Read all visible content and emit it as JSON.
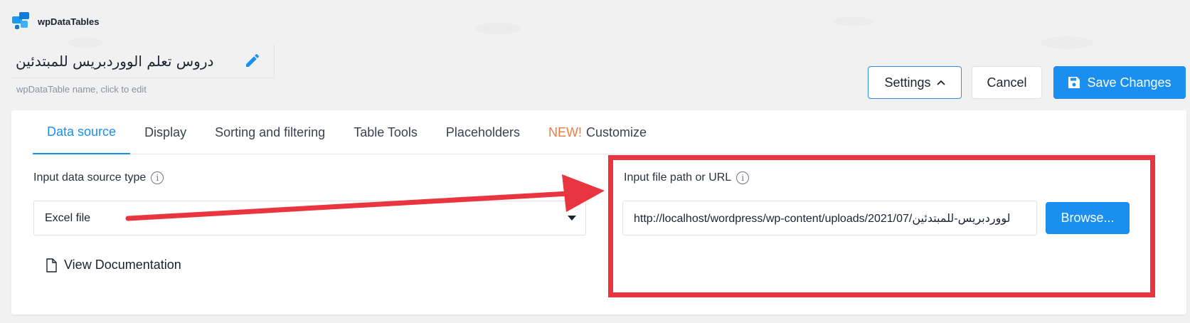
{
  "app": {
    "logo_text": "wpDataTables"
  },
  "table_name": {
    "value": "دروس تعلم الووردبريس للمبتدئين",
    "hint": "wpDataTable name, click to edit"
  },
  "toolbar": {
    "settings_label": "Settings",
    "cancel_label": "Cancel",
    "save_label": "Save Changes"
  },
  "tabs": [
    {
      "label": "Data source",
      "active": true
    },
    {
      "label": "Display"
    },
    {
      "label": "Sorting and filtering"
    },
    {
      "label": "Table Tools"
    },
    {
      "label": "Placeholders"
    },
    {
      "badge": "NEW!",
      "label": "Customize"
    }
  ],
  "data_source": {
    "type_label": "Input data source type",
    "type_value": "Excel file",
    "path_label": "Input file path or URL",
    "path_value": "http://localhost/wordpress/wp-content/uploads/2021/07/لووردبريس-للمبتدئين",
    "browse_label": "Browse...",
    "doc_link": "View Documentation"
  },
  "icons": {
    "logo": "wpdatatables-logo-icon",
    "edit": "pencil-icon",
    "chevron": "chevron-up-icon",
    "save": "floppy-disk-icon",
    "info": "info-icon",
    "caret": "caret-down-icon",
    "doc": "document-icon"
  },
  "colors": {
    "accent": "#1a8ff0",
    "annotation": "#e8353f",
    "new_badge": "#f07b3a"
  }
}
